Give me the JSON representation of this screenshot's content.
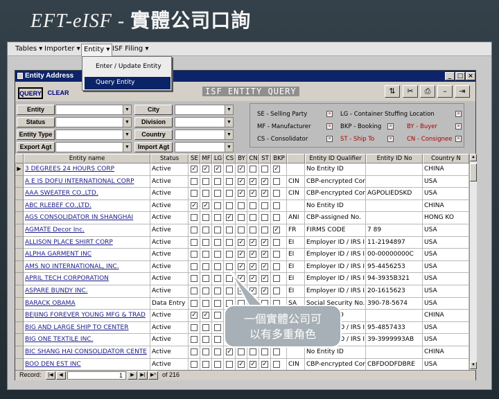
{
  "slide": {
    "title_en": "EFT-eISF - ",
    "title_zh": "實體公司口詢"
  },
  "menubar": {
    "items": [
      "Tables ▾",
      "Importer ▾",
      "Entity ▾",
      "ISF Filing ▾"
    ]
  },
  "entity_menu": {
    "items": [
      "Enter / Update Entity",
      "Query Entity"
    ]
  },
  "window": {
    "title": "Entity Address",
    "minimize": "_",
    "restore": "□",
    "close": "×"
  },
  "toolbar": {
    "query": "QUERY",
    "clear": "CLEAR",
    "title": "ISF ENTITY QUERY"
  },
  "filters": {
    "entity": "Entity",
    "status": "Status",
    "entity_type": "Entity Type",
    "export_agt": "Export Agt",
    "city": "City",
    "division": "Division",
    "country": "Country",
    "import_agt": "Import Agt"
  },
  "legend": {
    "sp": "SE - Selling Party",
    "mf": "MF - Manufacturer",
    "cs": "CS - Consolidator",
    "lg": "LG - Container Stuffing Location",
    "bkp": "BKP - Booking",
    "st": "ST - Ship To",
    "by": "BY - Buyer",
    "cn": "CN - Consignee"
  },
  "grid": {
    "headers": [
      "Entity name",
      "Status",
      "SE",
      "MF",
      "LG",
      "CS",
      "BY",
      "CN",
      "ST",
      "BKP",
      "",
      "Entity ID Qualifier",
      "Entity ID No",
      "Country N"
    ],
    "rows": [
      {
        "name": "3 DEGREES 24 HOURS CORP",
        "status": "Active",
        "flags": [
          1,
          1,
          1,
          0,
          1,
          0,
          0,
          1
        ],
        "code": "",
        "qual": "No Entity ID",
        "idno": "",
        "country": "CHINA"
      },
      {
        "name": "A E IS DOFU INTERNATIONAL CORP",
        "status": "Active",
        "flags": [
          0,
          0,
          0,
          0,
          1,
          1,
          1,
          0
        ],
        "code": "CIN",
        "qual": "CBP-encrypted Cor",
        "idno": "",
        "country": "USA"
      },
      {
        "name": "AAA SWEATER CO.,LTD.",
        "status": "Active",
        "flags": [
          0,
          0,
          0,
          0,
          1,
          1,
          1,
          0
        ],
        "code": "CIN",
        "qual": "CBP-encrypted Cor",
        "idno": "AGPOLIEDSKD",
        "country": "USA"
      },
      {
        "name": "ABC RLEBEF CO.,LTD.",
        "status": "Active",
        "flags": [
          1,
          1,
          0,
          0,
          0,
          0,
          0,
          0
        ],
        "code": "",
        "qual": "No Entity ID",
        "idno": "",
        "country": "CHINA"
      },
      {
        "name": "AGS CONSOLIDATOR IN SHANGHAI",
        "status": "Active",
        "flags": [
          0,
          0,
          0,
          1,
          0,
          0,
          0,
          0
        ],
        "code": "ANI",
        "qual": "CBP-assigned No.",
        "idno": "",
        "country": "HONG KO"
      },
      {
        "name": "AGMATE Decor Inc.",
        "status": "Active",
        "flags": [
          0,
          0,
          0,
          0,
          0,
          0,
          0,
          1
        ],
        "code": "FR",
        "qual": "FIRMS CODE",
        "idno": "7 89",
        "country": "USA"
      },
      {
        "name": "ALLISON PLACE SHIRT CORP",
        "status": "Active",
        "flags": [
          0,
          0,
          0,
          0,
          1,
          1,
          1,
          0
        ],
        "code": "EI",
        "qual": "Employer ID / IRS I",
        "idno": "11-2194897",
        "country": "USA"
      },
      {
        "name": "ALPHA GARMENT INC",
        "status": "Active",
        "flags": [
          0,
          0,
          0,
          0,
          1,
          1,
          1,
          0
        ],
        "code": "EI",
        "qual": "Employer ID / IRS I",
        "idno": "00-00000000C",
        "country": "USA"
      },
      {
        "name": "AMS NO INTERNATIONAL, INC.",
        "status": "Active",
        "flags": [
          0,
          0,
          0,
          0,
          1,
          1,
          1,
          0
        ],
        "code": "EI",
        "qual": "Employer ID / IRS I",
        "idno": "95-4456253",
        "country": "USA"
      },
      {
        "name": "APRIL TECH CORPORATION",
        "status": "Active",
        "flags": [
          0,
          0,
          0,
          0,
          1,
          1,
          1,
          0
        ],
        "code": "EI",
        "qual": "Employer ID / IRS I",
        "idno": "94-3935B321",
        "country": "USA"
      },
      {
        "name": "ASPARE BUNDY INC.",
        "status": "Active",
        "flags": [
          0,
          0,
          0,
          0,
          1,
          1,
          1,
          0
        ],
        "code": "EI",
        "qual": "Employer ID / IRS I",
        "idno": "20-1615623",
        "country": "USA"
      },
      {
        "name": "BARACK OBAMA",
        "status": "Data Entry",
        "flags": [
          0,
          0,
          0,
          0,
          0,
          0,
          0,
          0
        ],
        "code": "SA",
        "qual": "Social Security No.",
        "idno": "390-78-5674",
        "country": "USA"
      },
      {
        "name": "BEIJING FOREVER YOUNG MFG & TRAD",
        "status": "Active",
        "flags": [
          1,
          1,
          0,
          0,
          0,
          0,
          0,
          0
        ],
        "code": "",
        "qual": "No Entity ID",
        "idno": "",
        "country": "CHINA"
      },
      {
        "name": "BIG AND LARGE SHIP TO CENTER",
        "status": "Active",
        "flags": [
          0,
          0,
          0,
          0,
          0,
          0,
          1,
          0
        ],
        "code": "EI",
        "qual": "Employer ID / IRS I",
        "idno": "95-4857433",
        "country": "USA"
      },
      {
        "name": "BIG ONE TEXTILE INC.",
        "status": "Active",
        "flags": [
          0,
          0,
          0,
          0,
          1,
          1,
          1,
          0
        ],
        "code": "EI",
        "qual": "Employer ID / IRS I",
        "idno": "39-3999993AB",
        "country": "USA"
      },
      {
        "name": "BIC SHANG HAI CONSOLIDATOR CENTE",
        "status": "Active",
        "flags": [
          0,
          0,
          0,
          1,
          0,
          0,
          0,
          0
        ],
        "code": "",
        "qual": "No Entity ID",
        "idno": "",
        "country": "CHINA"
      },
      {
        "name": "BOO DEN EST INC",
        "status": "Active",
        "flags": [
          0,
          0,
          0,
          0,
          1,
          1,
          1,
          0
        ],
        "code": "CIN",
        "qual": "CBP-encrypted Cor",
        "idno": "CBFDODFDBRE",
        "country": "USA"
      }
    ]
  },
  "status_bar": {
    "record_label": "Record:",
    "current": "1",
    "of_label": "of  216"
  },
  "callout": {
    "line1": "一個實體公司可",
    "line2": "以有多重角色"
  }
}
